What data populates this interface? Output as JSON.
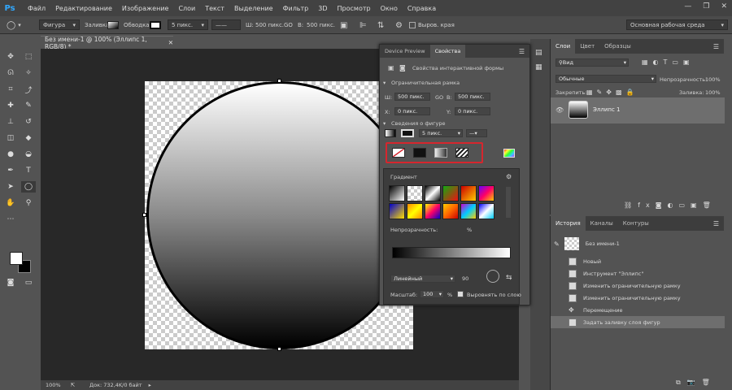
{
  "menu": {
    "logo": "Ps",
    "items": [
      "Файл",
      "Редактирование",
      "Изображение",
      "Слои",
      "Текст",
      "Выделение",
      "Фильтр",
      "3D",
      "Просмотр",
      "Окно",
      "Справка"
    ]
  },
  "options_bar": {
    "mode": "Фигура",
    "fill_label": "Заливка:",
    "stroke_label": "Обводка:",
    "stroke_size": "5 пикс.",
    "w_label": "Ш:",
    "w_value": "500 пикс.",
    "link_label": "GO",
    "h_label": "В:",
    "h_value": "500 пикс.",
    "align_edges": "Выров. края",
    "workspace": "Основная рабочая среда"
  },
  "document": {
    "tab_title": "Без имени-1 @ 100% (Эллипс 1, RGB/8) *",
    "zoom": "100%",
    "doc_info": "Док: 732,4K/0 байт"
  },
  "properties": {
    "tabs": [
      "Device Preview",
      "Свойства"
    ],
    "header": "Свойства интерактивной формы",
    "bbox_section": "Ограничительная рамка",
    "w_label": "Ш:",
    "w_value": "500 пикс.",
    "go_label": "GO",
    "h_label": "В:",
    "h_value": "500 пикс.",
    "x_label": "X:",
    "x_value": "0 пикс.",
    "y_label": "Y:",
    "y_value": "0 пикс.",
    "shape_section": "Сведения о фигуре",
    "stroke_size": "5 пикс.",
    "gradient_label": "Градиент",
    "opacity_label": "Непрозрачность:",
    "opacity_unit": "%",
    "style": "Линейный",
    "angle": "90",
    "scale_label": "Масштаб:",
    "scale_value": "100",
    "scale_unit": "%",
    "align_layer": "Выровнять по слою"
  },
  "layers": {
    "tabs": [
      "Слои",
      "Цвет",
      "Образцы"
    ],
    "kind": "Вид",
    "blend": "Обычные",
    "opacity_label": "Непрозрачность:",
    "opacity_value": "100%",
    "lock_label": "Закрепить:",
    "fill_label": "Заливка:",
    "fill_value": "100%",
    "layer_name": "Эллипс 1"
  },
  "history": {
    "tabs": [
      "История",
      "Каналы",
      "Контуры"
    ],
    "snapshot": "Без имени-1",
    "items": [
      "Новый",
      "Инструмент \"Эллипс\"",
      "Изменить ограничительную рамку",
      "Изменить ограничительную рамку",
      "Перемещение",
      "Задать заливку слоя фигур"
    ]
  },
  "colors": {
    "accent_red": "#d6262e",
    "ps_blue": "#31a8ff"
  }
}
